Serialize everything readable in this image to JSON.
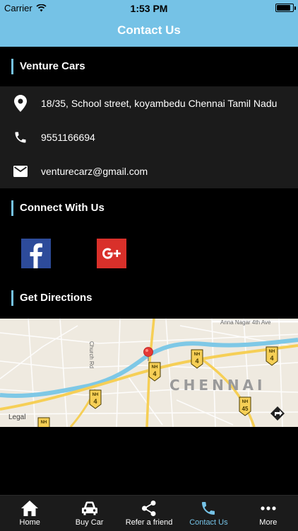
{
  "status_bar": {
    "carrier": "Carrier",
    "time": "1:53 PM"
  },
  "header": {
    "title": "Contact Us"
  },
  "business": {
    "name": "Venture Cars",
    "address": "18/35, School street, koyambedu Chennai Tamil Nadu",
    "phone": "9551166694",
    "email": "venturecarz@gmail.com"
  },
  "connect": {
    "title": "Connect With Us"
  },
  "directions": {
    "title": "Get Directions"
  },
  "map": {
    "city_label": "CHENNAI",
    "road_anna_nagar": "Anna Nagar 4th Ave",
    "road_church": "Church Rd",
    "legal": "Legal",
    "nh_prefix": "NH",
    "nh_4": "4",
    "nh_45": "45"
  },
  "tabs": [
    {
      "label": "Home",
      "icon": "home-icon"
    },
    {
      "label": "Buy Car",
      "icon": "car-icon"
    },
    {
      "label": "Refer a friend",
      "icon": "share-icon"
    },
    {
      "label": "Contact Us",
      "icon": "phone-icon"
    },
    {
      "label": "More",
      "icon": "more-icon"
    }
  ],
  "colors": {
    "accent": "#75c2e6",
    "facebook": "#2d4b9a",
    "google_plus": "#d9302a",
    "pin": "#e53935"
  }
}
